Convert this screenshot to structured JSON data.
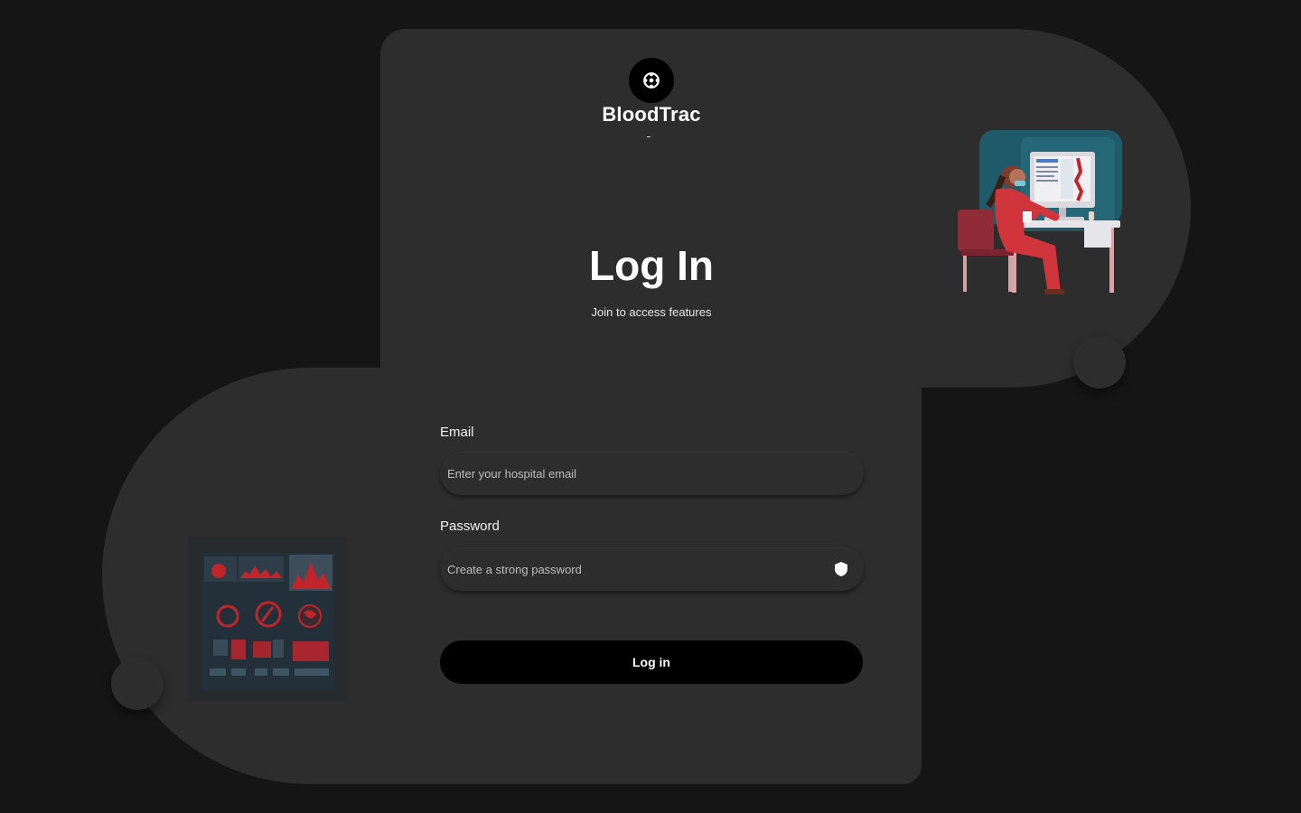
{
  "brand": {
    "name": "BloodTrac",
    "logo_icon": "gear-icon",
    "dot": "-"
  },
  "page": {
    "title": "Log In",
    "subtitle": "Join to access features"
  },
  "form": {
    "email": {
      "label": "Email",
      "placeholder": "Enter your hospital email",
      "value": ""
    },
    "password": {
      "label": "Password",
      "placeholder": "Create a strong password",
      "value": "",
      "icon": "shield-icon"
    },
    "submit_label": "Log in"
  },
  "illustrations": {
    "right": "nurse-at-computer-illustration",
    "left": "dashboard-illustration"
  },
  "colors": {
    "background": "#151515",
    "panel": "#2d2d2d",
    "button": "#000000",
    "accent": "#c0252b"
  }
}
